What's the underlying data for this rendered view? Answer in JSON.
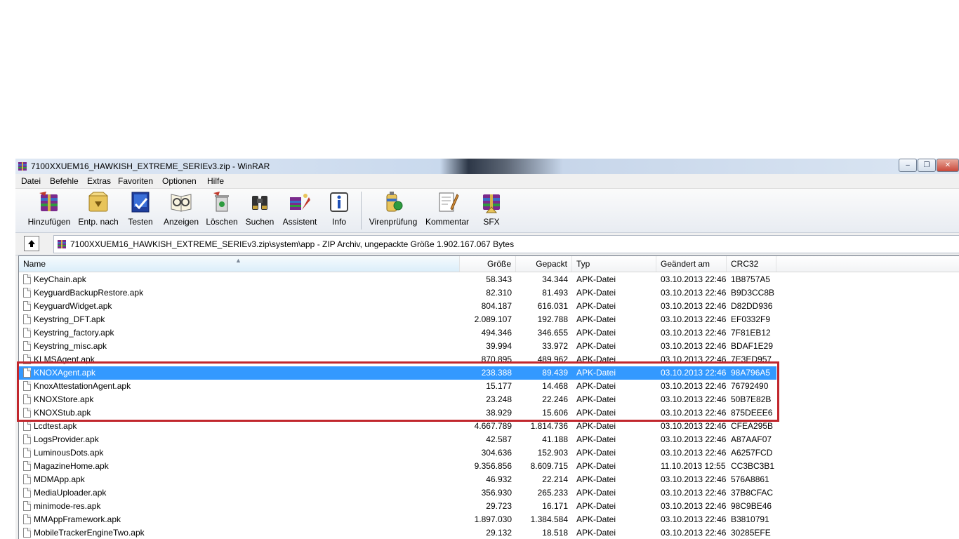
{
  "window": {
    "title": "7100XXUEM16_HAWKISH_EXTREME_SERIEv3.zip - WinRAR",
    "controls": [
      "–",
      "❐",
      "✕"
    ]
  },
  "menu": [
    "Datei",
    "Befehle",
    "Extras",
    "Favoriten",
    "Optionen",
    "Hilfe"
  ],
  "toolbar": {
    "buttons": [
      {
        "label": "Hinzufügen",
        "icon": "add-archive-icon"
      },
      {
        "label": "Entp. nach",
        "icon": "extract-icon"
      },
      {
        "label": "Testen",
        "icon": "test-icon"
      },
      {
        "label": "Anzeigen",
        "icon": "view-icon"
      },
      {
        "label": "Löschen",
        "icon": "delete-icon"
      },
      {
        "label": "Suchen",
        "icon": "find-icon"
      },
      {
        "label": "Assistent",
        "icon": "wizard-icon"
      },
      {
        "label": "Info",
        "icon": "info-icon"
      },
      {
        "label": "Virenprüfung",
        "icon": "virus-scan-icon"
      },
      {
        "label": "Kommentar",
        "icon": "comment-icon"
      },
      {
        "label": "SFX",
        "icon": "sfx-icon"
      }
    ]
  },
  "address": {
    "up_icon": "up-folder-icon",
    "path": "7100XXUEM16_HAWKISH_EXTREME_SERIEv3.zip\\system\\app - ZIP Archiv, ungepackte Größe 1.902.167.067 Bytes"
  },
  "columns": {
    "name": "Name",
    "size": "Größe",
    "packed": "Gepackt",
    "type": "Typ",
    "modified": "Geändert am",
    "crc": "CRC32"
  },
  "files": [
    {
      "name": "KeyChain.apk",
      "size": "58.343",
      "packed": "34.344",
      "type": "APK-Datei",
      "modified": "03.10.2013 22:46",
      "crc": "1B8757A5"
    },
    {
      "name": "KeyguardBackupRestore.apk",
      "size": "82.310",
      "packed": "81.493",
      "type": "APK-Datei",
      "modified": "03.10.2013 22:46",
      "crc": "B9D3CC8B"
    },
    {
      "name": "KeyguardWidget.apk",
      "size": "804.187",
      "packed": "616.031",
      "type": "APK-Datei",
      "modified": "03.10.2013 22:46",
      "crc": "D82DD936"
    },
    {
      "name": "Keystring_DFT.apk",
      "size": "2.089.107",
      "packed": "192.788",
      "type": "APK-Datei",
      "modified": "03.10.2013 22:46",
      "crc": "EF0332F9"
    },
    {
      "name": "Keystring_factory.apk",
      "size": "494.346",
      "packed": "346.655",
      "type": "APK-Datei",
      "modified": "03.10.2013 22:46",
      "crc": "7F81EB12"
    },
    {
      "name": "Keystring_misc.apk",
      "size": "39.994",
      "packed": "33.972",
      "type": "APK-Datei",
      "modified": "03.10.2013 22:46",
      "crc": "BDAF1E29"
    },
    {
      "name": "KLMSAgent.apk",
      "size": "870.895",
      "packed": "489.962",
      "type": "APK-Datei",
      "modified": "03.10.2013 22:46",
      "crc": "7E3ED957"
    },
    {
      "name": "KNOXAgent.apk",
      "size": "238.388",
      "packed": "89.439",
      "type": "APK-Datei",
      "modified": "03.10.2013 22:46",
      "crc": "98A796A5",
      "selected": true
    },
    {
      "name": "KnoxAttestationAgent.apk",
      "size": "15.177",
      "packed": "14.468",
      "type": "APK-Datei",
      "modified": "03.10.2013 22:46",
      "crc": "76792490"
    },
    {
      "name": "KNOXStore.apk",
      "size": "23.248",
      "packed": "22.246",
      "type": "APK-Datei",
      "modified": "03.10.2013 22:46",
      "crc": "50B7E82B"
    },
    {
      "name": "KNOXStub.apk",
      "size": "38.929",
      "packed": "15.606",
      "type": "APK-Datei",
      "modified": "03.10.2013 22:46",
      "crc": "875DEEE6"
    },
    {
      "name": "Lcdtest.apk",
      "size": "4.667.789",
      "packed": "1.814.736",
      "type": "APK-Datei",
      "modified": "03.10.2013 22:46",
      "crc": "CFEA295B"
    },
    {
      "name": "LogsProvider.apk",
      "size": "42.587",
      "packed": "41.188",
      "type": "APK-Datei",
      "modified": "03.10.2013 22:46",
      "crc": "A87AAF07"
    },
    {
      "name": "LuminousDots.apk",
      "size": "304.636",
      "packed": "152.903",
      "type": "APK-Datei",
      "modified": "03.10.2013 22:46",
      "crc": "A6257FCD"
    },
    {
      "name": "MagazineHome.apk",
      "size": "9.356.856",
      "packed": "8.609.715",
      "type": "APK-Datei",
      "modified": "11.10.2013 12:55",
      "crc": "CC3BC3B1"
    },
    {
      "name": "MDMApp.apk",
      "size": "46.932",
      "packed": "22.214",
      "type": "APK-Datei",
      "modified": "03.10.2013 22:46",
      "crc": "576A8861"
    },
    {
      "name": "MediaUploader.apk",
      "size": "356.930",
      "packed": "265.233",
      "type": "APK-Datei",
      "modified": "03.10.2013 22:46",
      "crc": "37B8CFAC"
    },
    {
      "name": "minimode-res.apk",
      "size": "29.723",
      "packed": "16.171",
      "type": "APK-Datei",
      "modified": "03.10.2013 22:46",
      "crc": "98C9BE46"
    },
    {
      "name": "MMAppFramework.apk",
      "size": "1.897.030",
      "packed": "1.384.584",
      "type": "APK-Datei",
      "modified": "03.10.2013 22:46",
      "crc": "B3810791"
    },
    {
      "name": "MobileTrackerEngineTwo.apk",
      "size": "29.132",
      "packed": "18.518",
      "type": "APK-Datei",
      "modified": "03.10.2013 22:46",
      "crc": "30285EFE"
    }
  ],
  "colors": {
    "selection": "#3399ff",
    "highlight_box": "#c1272d"
  }
}
